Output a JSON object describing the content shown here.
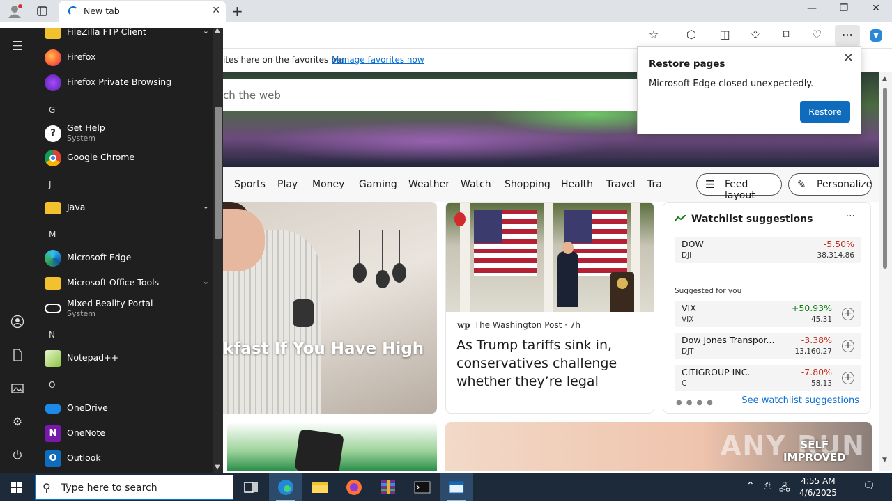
{
  "browser": {
    "tab_title": "New tab",
    "favbar_text": "ites here on the favorites bar.",
    "favbar_link": "Manage favorites now"
  },
  "search": {
    "placeholder": "ch the web"
  },
  "nav": {
    "items": [
      "Sports",
      "Play",
      "Money",
      "Gaming",
      "Weather",
      "Watch",
      "Shopping",
      "Health",
      "Travel",
      "Tra"
    ],
    "feed_layout": "Feed layout",
    "personalize": "Personalize"
  },
  "cards": {
    "main_headline": "kfast If You Have High",
    "news_source": "The Washington Post",
    "news_source_logo": "wp",
    "news_time": "· 7h",
    "news_title": "As Trump tariffs sink in, conservatives challenge whether they’re legal"
  },
  "watchlist": {
    "title": "Watchlist suggestions",
    "more": "···",
    "suggested_label": "Suggested for you",
    "see_more": "See watchlist suggestions",
    "items": [
      {
        "name": "DOW",
        "symbol": "DJI",
        "change": "-5.50%",
        "price": "38,314.86"
      },
      {
        "name": "VIX",
        "symbol": "VIX",
        "change": "+50.93%",
        "price": "45.31"
      },
      {
        "name": "Dow Jones Transpor...",
        "symbol": "DJT",
        "change": "-3.38%",
        "price": "13,160.27"
      },
      {
        "name": "CITIGROUP INC.",
        "symbol": "C",
        "change": "-7.80%",
        "price": "58.13"
      }
    ]
  },
  "popup": {
    "title": "Restore pages",
    "message": "Microsoft Edge closed unexpectedly.",
    "button": "Restore"
  },
  "watermark": {
    "main": "ANY RUN",
    "badge_line1": "SELF",
    "badge_line2": "IMPROVED"
  },
  "start_menu": {
    "apps": [
      {
        "name": "FileZilla FTP Client",
        "expandable": true
      },
      {
        "name": "Firefox"
      },
      {
        "name": "Firefox Private Browsing"
      },
      {
        "letter": "G"
      },
      {
        "name": "Get Help",
        "sub": "System"
      },
      {
        "name": "Google Chrome"
      },
      {
        "letter": "J"
      },
      {
        "name": "Java",
        "expandable": true
      },
      {
        "letter": "M"
      },
      {
        "name": "Microsoft Edge"
      },
      {
        "name": "Microsoft Office Tools",
        "expandable": true
      },
      {
        "name": "Mixed Reality Portal",
        "sub": "System"
      },
      {
        "letter": "N"
      },
      {
        "name": "Notepad++"
      },
      {
        "letter": "O"
      },
      {
        "name": "OneDrive"
      },
      {
        "name": "OneNote"
      },
      {
        "name": "Outlook"
      }
    ]
  },
  "taskbar": {
    "search_placeholder": "Type here to search",
    "time": "4:55 AM",
    "date": "4/6/2025"
  },
  "colors": {
    "accent": "#0f6cbd",
    "negative": "#c42b1c",
    "positive": "#107c10",
    "taskbar": "#1c2a3a"
  }
}
